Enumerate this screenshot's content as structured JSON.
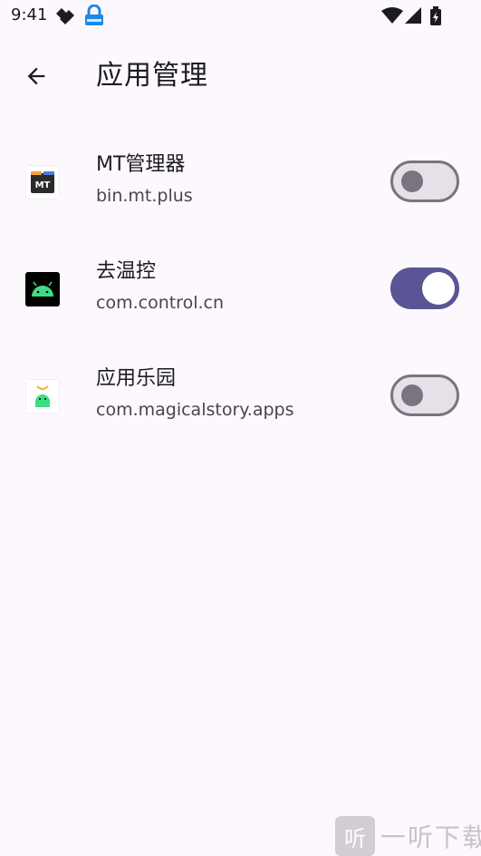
{
  "status_bar": {
    "time": "9:41",
    "left_icons": [
      "diamond-notification-icon",
      "lock-badge-icon"
    ],
    "right_icons": [
      "wifi-icon",
      "signal-icon",
      "battery-charging-icon"
    ]
  },
  "header": {
    "title": "应用管理",
    "back_icon": "arrow-back-icon"
  },
  "apps": [
    {
      "name": "MT管理器",
      "package": "bin.mt.plus",
      "enabled": false,
      "icon": "mt-manager-app-icon"
    },
    {
      "name": "去温控",
      "package": "com.control.cn",
      "enabled": true,
      "icon": "android-app-icon"
    },
    {
      "name": "应用乐园",
      "package": "com.magicalstory.apps",
      "enabled": false,
      "icon": "android-app-icon"
    }
  ],
  "colors": {
    "background": "#fdf8fd",
    "switch_on_track": "#5b5494",
    "switch_off_track": "#e6e0e9",
    "switch_off_outline": "#79747e"
  },
  "watermark": {
    "badge": "听",
    "text": "一听下载"
  }
}
